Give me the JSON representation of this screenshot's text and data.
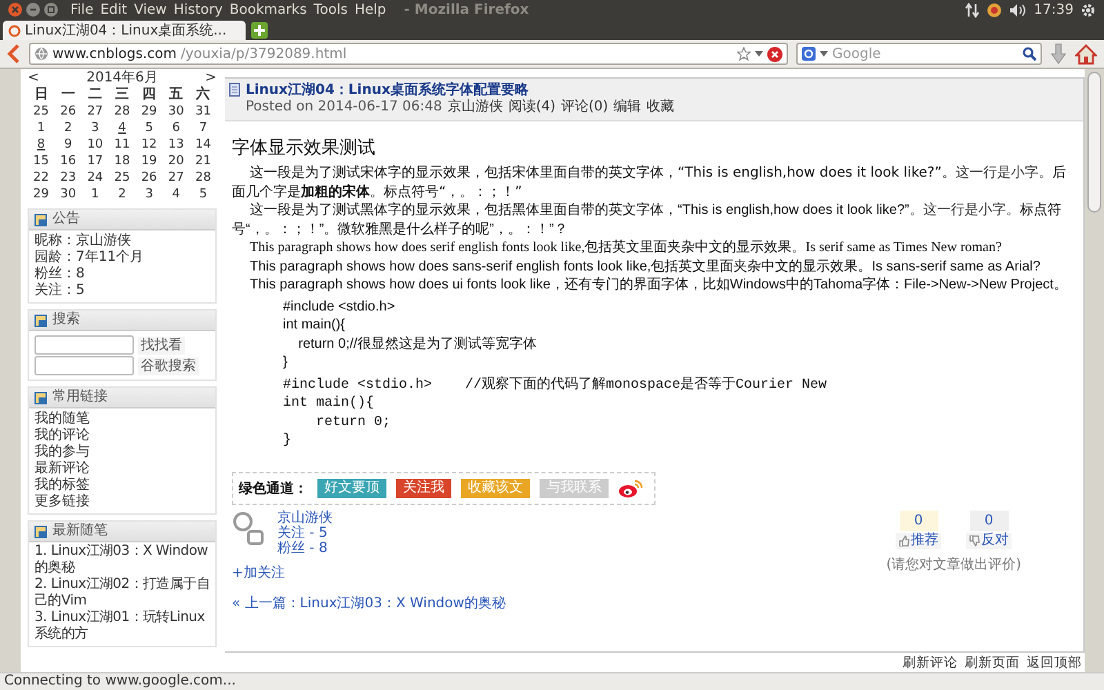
{
  "window": {
    "menu": [
      "File",
      "Edit",
      "View",
      "History",
      "Bookmarks",
      "Tools",
      "Help"
    ],
    "title": "- Mozilla Firefox",
    "clock": "17:39"
  },
  "tabs": [
    {
      "label": "Linux江湖04：Linux桌面系统...",
      "selected": true
    }
  ],
  "address": {
    "domain": "www.cnblogs.com",
    "path": "/youxia/p/3792089.html"
  },
  "search": {
    "placeholder": "Google"
  },
  "calendar": {
    "prev": "<",
    "title": "2014年6月",
    "next": ">",
    "weekdays": [
      "日",
      "一",
      "二",
      "三",
      "四",
      "五",
      "六"
    ],
    "weeks": [
      [
        {
          "text": "25",
          "link": false
        },
        {
          "text": "26",
          "link": false
        },
        {
          "text": "27",
          "link": false
        },
        {
          "text": "28",
          "link": false
        },
        {
          "text": "29",
          "link": false
        },
        {
          "text": "30",
          "link": false
        },
        {
          "text": "31",
          "link": false
        }
      ],
      [
        {
          "text": "1",
          "link": false
        },
        {
          "text": "2",
          "link": false
        },
        {
          "text": "3",
          "link": false
        },
        {
          "text": "4",
          "link": true
        },
        {
          "text": "5",
          "link": false
        },
        {
          "text": "6",
          "link": false
        },
        {
          "text": "7",
          "link": false
        }
      ],
      [
        {
          "text": "8",
          "link": true
        },
        {
          "text": "9",
          "link": false
        },
        {
          "text": "10",
          "link": false
        },
        {
          "text": "11",
          "link": false
        },
        {
          "text": "12",
          "link": false
        },
        {
          "text": "13",
          "link": false
        },
        {
          "text": "14",
          "link": false
        }
      ],
      [
        {
          "text": "15",
          "link": false
        },
        {
          "text": "16",
          "link": false
        },
        {
          "text": "17",
          "link": false
        },
        {
          "text": "18",
          "link": false
        },
        {
          "text": "19",
          "link": false
        },
        {
          "text": "20",
          "link": false
        },
        {
          "text": "21",
          "link": false
        }
      ],
      [
        {
          "text": "22",
          "link": false
        },
        {
          "text": "23",
          "link": false
        },
        {
          "text": "24",
          "link": false
        },
        {
          "text": "25",
          "link": false
        },
        {
          "text": "26",
          "link": false
        },
        {
          "text": "27",
          "link": false
        },
        {
          "text": "28",
          "link": false
        }
      ],
      [
        {
          "text": "29",
          "link": false
        },
        {
          "text": "30",
          "link": false
        },
        {
          "text": "1",
          "link": false
        },
        {
          "text": "2",
          "link": false
        },
        {
          "text": "3",
          "link": false
        },
        {
          "text": "4",
          "link": false
        },
        {
          "text": "5",
          "link": false
        }
      ]
    ]
  },
  "notice": {
    "title": "公告",
    "lines": [
      "昵称：京山游侠",
      "园龄：7年11个月",
      "粉丝：8",
      "关注：5"
    ]
  },
  "site_search": {
    "title": "搜索",
    "buttons": [
      "找找看",
      "谷歌搜索"
    ]
  },
  "common_links": {
    "title": "常用链接",
    "items": [
      "我的随笔",
      "我的评论",
      "我的参与",
      "最新评论",
      "我的标签",
      "更多链接"
    ]
  },
  "recent_posts": {
    "title": "最新随笔",
    "items": [
      "1. Linux江湖03：X Window的奥秘",
      "2. Linux江湖02：打造属于自己的Vim",
      "3. Linux江湖01：玩转Linux系统的方"
    ]
  },
  "post": {
    "title": "Linux江湖04：Linux桌面系统字体配置要略",
    "posted": "Posted on 2014-06-17 06:48",
    "meta_links": [
      "京山游侠",
      "阅读(4)",
      "评论(0)",
      "编辑",
      "收藏"
    ],
    "heading": "字体显示效果测试",
    "paragraphs": [
      {
        "kind": "song",
        "segments": [
          {
            "kind": "text",
            "text": "这一段是为了测试宋体字的显示效果，包括宋体里面自带的英文字体，“This is english,how does it look like?”。"
          },
          {
            "kind": "small",
            "text": "这一行是小字。"
          },
          {
            "kind": "text",
            "text": "后面几个字是**加粗的宋体**。标点符号“，。：；！”"
          }
        ]
      },
      {
        "kind": "hei",
        "segments": [
          {
            "kind": "text",
            "text": "这一段是为了测试黑体字的显示效果，包括黑体里面自带的英文字体，“This is english,how does it look like?”。"
          },
          {
            "kind": "small",
            "text": "这一行是小字。"
          },
          {
            "kind": "text",
            "text": "标点符号“，。：；！”。微软雅黑是什么样子的呢”，。：！”？"
          }
        ]
      },
      {
        "kind": "serif",
        "segments": [
          {
            "kind": "text",
            "text": "This paragraph shows how does serif english fonts look like,包括英文里面夹杂中文的显示效果。Is serif same as Times New roman?"
          }
        ]
      },
      {
        "kind": "sans",
        "segments": [
          {
            "kind": "text",
            "text": "This paragraph shows how does sans-serif english fonts look like,包括英文里面夹杂中文的显示效果。Is sans-serif same as Arial?"
          }
        ]
      },
      {
        "kind": "ui",
        "segments": [
          {
            "kind": "text",
            "text": "This paragraph shows how does ui fonts look like，还有专门的界面字体，比如Windows中的Tahoma字体：File->New->New Project。"
          }
        ]
      }
    ],
    "code_blocks": [
      {
        "kind": "sans",
        "lines": [
          "#include <stdio.h>",
          "int main(){",
          "    return 0;//很显然这是为了测试等宽字体",
          "}"
        ]
      },
      {
        "kind": "mono",
        "lines": [
          "#include <stdio.h>    //观察下面的代码了解monospace是否等于Courier New",
          "int main(){",
          "    return 0;",
          "}"
        ]
      }
    ]
  },
  "share": {
    "label": "绿色通道：",
    "buttons": [
      {
        "label": "好文要顶",
        "color": "#3aa5b3"
      },
      {
        "label": "关注我",
        "color": "#d8452a"
      },
      {
        "label": "收藏该文",
        "color": "#e9a624"
      },
      {
        "label": "与我联系",
        "color": "#cccccc"
      }
    ]
  },
  "author": {
    "links": [
      "京山游侠",
      "关注 - 5",
      "粉丝 - 8"
    ],
    "follow": "+加关注"
  },
  "votes": [
    {
      "kind": "up",
      "count": "0",
      "label": "推荐"
    },
    {
      "kind": "down",
      "count": "0",
      "label": "反对"
    }
  ],
  "vote_hint": "(请您对文章做出评价)",
  "prev_post": {
    "label": "« 上一篇：",
    "link": "Linux江湖03：X Window的奥秘"
  },
  "footer_links": [
    "刷新评论",
    "刷新页面",
    "返回顶部"
  ],
  "status_bar": "Connecting to www.google.com..."
}
